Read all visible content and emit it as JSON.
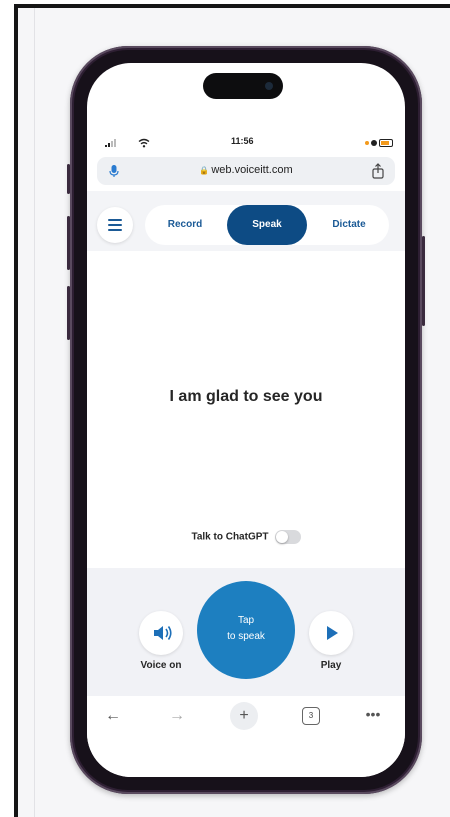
{
  "status_bar": {
    "time": "11:56"
  },
  "browser": {
    "url": "web.voiceitt.com"
  },
  "tabs": [
    {
      "label": "Record",
      "active": false
    },
    {
      "label": "Speak",
      "active": true
    },
    {
      "label": "Dictate",
      "active": false
    }
  ],
  "main": {
    "phrase": "I am glad to see you"
  },
  "chatgpt": {
    "label": "Talk to ChatGPT",
    "enabled": false
  },
  "controls": {
    "voice_label": "Voice on",
    "tap_line1": "Tap",
    "tap_line2": "to speak",
    "play_label": "Play"
  },
  "toolbar": {
    "tab_count": "3"
  },
  "colors": {
    "brand_dark": "#0d4b84",
    "tap_button": "#1d7fc0",
    "accent_orange": "#f39a1c",
    "phone_frame": "#2e1f33"
  },
  "icons": [
    "mic-icon",
    "lock-icon",
    "share-icon",
    "menu-icon",
    "speaker-icon",
    "play-icon",
    "back-arrow-icon",
    "forward-arrow-icon",
    "plus-icon",
    "tabs-icon",
    "more-icon"
  ]
}
